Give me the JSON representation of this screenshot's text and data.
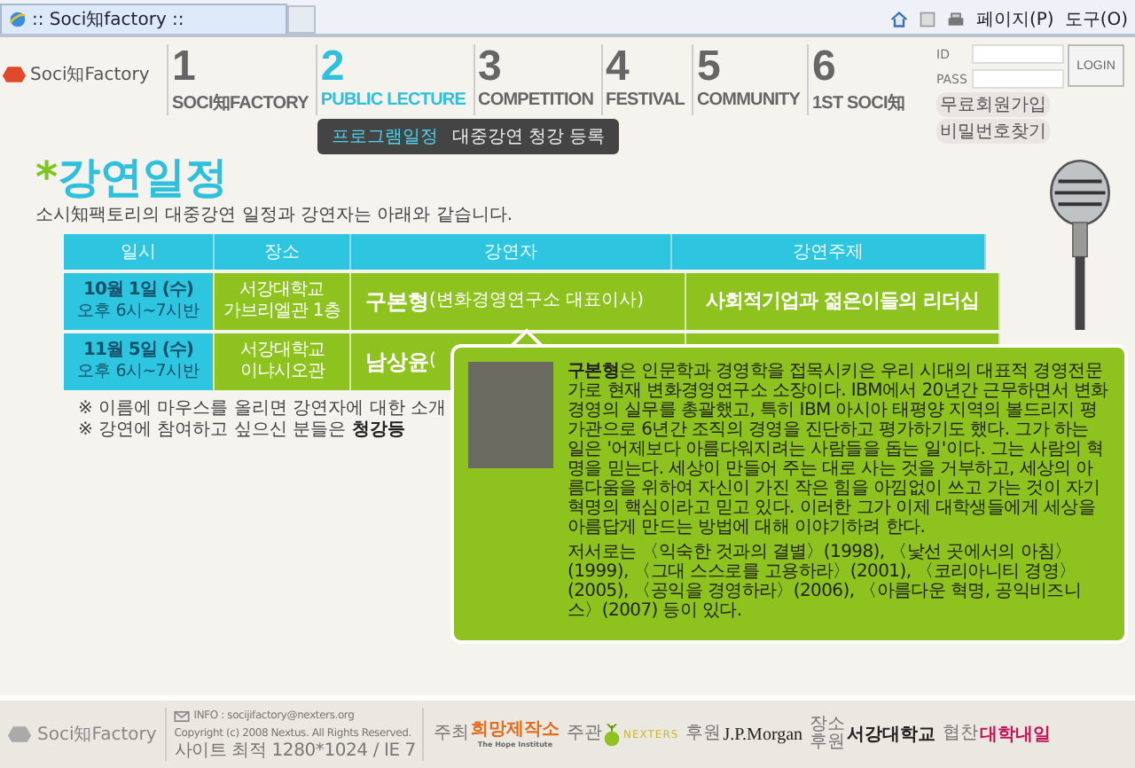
{
  "browser": {
    "tab_title": ":: Soci知factory ::",
    "page_menu": "페이지(P)",
    "tools_menu": "도구(O)"
  },
  "header": {
    "logo": "Soci知Factory",
    "nav": [
      {
        "number": "1",
        "label": "SOCI知FACTORY",
        "selected": false
      },
      {
        "number": "2",
        "label": "PUBLIC LECTURE",
        "selected": true
      },
      {
        "number": "3",
        "label": "COMPETITION",
        "selected": false
      },
      {
        "number": "4",
        "label": "FESTIVAL",
        "selected": false
      },
      {
        "number": "5",
        "label": "COMMUNITY",
        "selected": false
      },
      {
        "number": "6",
        "label": "1ST SOCI知",
        "selected": false
      }
    ],
    "submenu": [
      {
        "label": "프로그램일정",
        "selected": true
      },
      {
        "label": "대중강연 청강 등록",
        "selected": false
      }
    ],
    "login": {
      "id_label": "ID",
      "pass_label": "PASS",
      "button": "LOGIN",
      "links": [
        "무료회원가입",
        "비밀번호찾기"
      ]
    }
  },
  "heading": {
    "mark": "*",
    "title": "강연일정",
    "subtitle": "소시知팩토리의 대중강연 일정과 강연자는 아래와 같습니다."
  },
  "table": {
    "columns": [
      "일시",
      "장소",
      "강연자",
      "강연주제"
    ],
    "rows": [
      {
        "date": "10월 1일 (수)",
        "time": "오후 6시~7시반",
        "place": [
          "서강대학교",
          "가브리엘관 1층"
        ],
        "speaker": "구본형",
        "affiliation": "(변화경영연구소 대표이사)",
        "topic": "사회적기업과 젊은이들의 리더십"
      },
      {
        "date": "11월 5일 (수)",
        "time": "오후 6시~7시반",
        "place": [
          "서강대학교",
          "이냐시오관"
        ],
        "speaker": "남상윤",
        "affiliation": "("
      }
    ]
  },
  "notes": [
    "※ 이름에 마우스를 올리면 강연자에 대한 소개",
    "※ 강연에 참여하고 싶으신 분들은 **청강등**"
  ],
  "popup": {
    "paragraphs": [
      "**구본형**은 인문학과 경영학을 접목시키은 우리 시대의 대표적 경영전문가로 현재 변화경영연구소 소장이다. IBM에서 20년간 근무하면서 변화경영의 실무를 총괄했고, 특히 IBM 아시아 태평양 지역의 볼드리지 평가관으로 6년간 조직의 경영을 진단하고 평가하기도 했다. 그가 하는 일은 '어제보다 아름다워지려는 사람들을 돕는 일'이다. 그는 사람의 혁명을 믿는다. 세상이 만들어 주는 대로 사는 것을 거부하고, 세상의 아름다움을 위하여 자신이 가진 작은 힘을 아낌없이 쓰고 가는 것이 자기혁명의 핵심이라고 믿고 있다. 이러한 그가 이제 대학생들에게 세상을 아름답게 만드는 방법에 대해 이야기하려 한다.",
      "저서로는 〈익숙한 것과의 결별〉(1998), 〈낯선 곳에서의 아침〉(1999), 〈그대 스스로를 고용하라〉(2001), 〈코리아니티 경영〉(2005), 〈공익을 경영하라〉(2006), 〈아름다운 혁명, 공익비즈니스〉(2007) 등이 있다."
    ]
  },
  "footer": {
    "logo": "Soci知Factory",
    "info": "INFO : socijifactory@nexters.org",
    "copyright": "Copyright (c) 2008 Nextus. All Rights Reserved.",
    "resolution": "사이트 최적 1280*1024 / IE 7",
    "sponsors": [
      {
        "role": "주최",
        "name": "희망제작소",
        "sub": "The Hope Institute",
        "kind": "hope"
      },
      {
        "role": "주관",
        "name": "NEXTERS",
        "kind": "nexters"
      },
      {
        "role": "후원",
        "name": "J.P.Morgan",
        "kind": "jpm"
      },
      {
        "role": "장소후원",
        "name": "서강대학교",
        "kind": "sogang"
      },
      {
        "role": "협찬",
        "name": "대학내일",
        "kind": "naeil"
      }
    ]
  }
}
